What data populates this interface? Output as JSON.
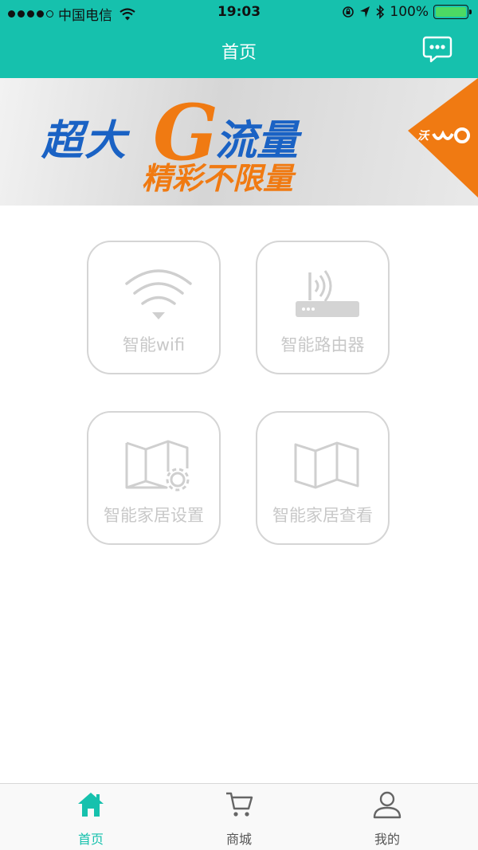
{
  "status_bar": {
    "carrier": "中国电信",
    "time": "19:03",
    "battery": "100%"
  },
  "navbar": {
    "title": "首页",
    "message_icon": "chat-bubble-icon"
  },
  "banner": {
    "line1_part1": "超大",
    "line1_g": "G",
    "line1_part2": "流量",
    "line2": "精彩不限量",
    "corner_text": "沃"
  },
  "tiles": [
    {
      "label": "智能wifi",
      "icon": "wifi-icon"
    },
    {
      "label": "智能路由器",
      "icon": "router-icon"
    },
    {
      "label": "智能家居设置",
      "icon": "map-gear-icon"
    },
    {
      "label": "智能家居查看",
      "icon": "map-icon"
    }
  ],
  "tabbar": {
    "tabs": [
      {
        "label": "首页",
        "icon": "home-icon",
        "active": true
      },
      {
        "label": "商城",
        "icon": "cart-icon",
        "active": false
      },
      {
        "label": "我的",
        "icon": "user-icon",
        "active": false
      }
    ]
  },
  "colors": {
    "accent": "#16c1ad",
    "banner_blue": "#1a62c4",
    "banner_orange": "#f07a12",
    "tile_border": "#d5d5d5",
    "tile_text": "#c8c8c8"
  }
}
